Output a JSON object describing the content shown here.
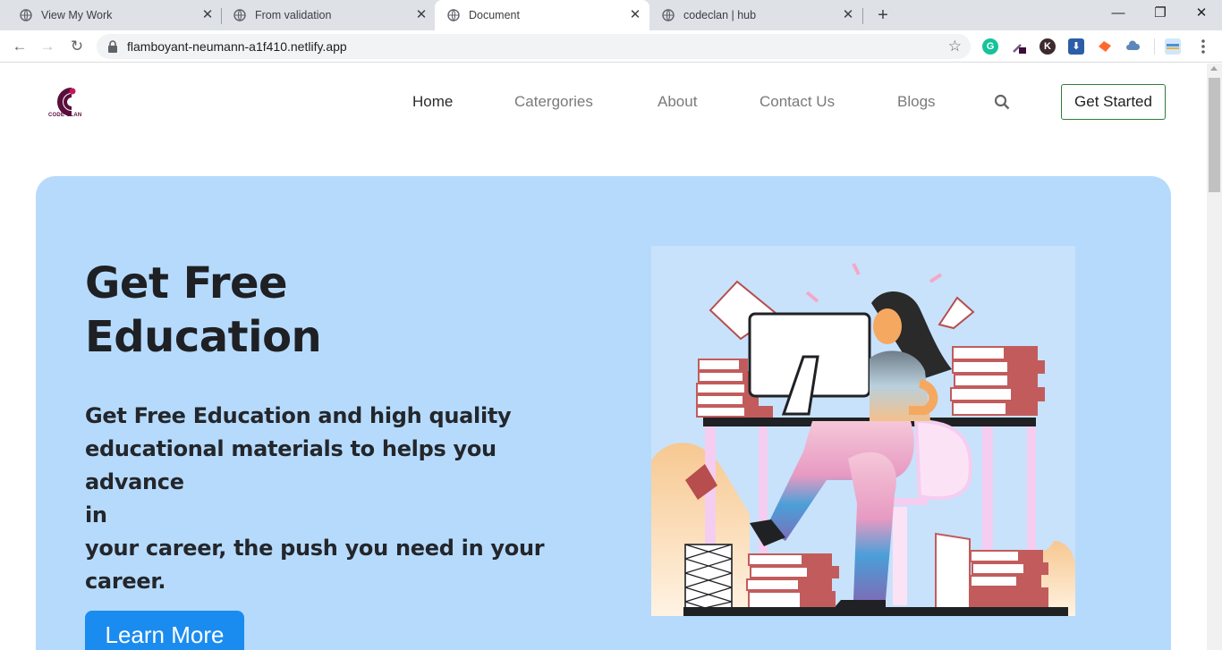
{
  "browser": {
    "tabs": [
      {
        "title": "View My Work",
        "active": false
      },
      {
        "title": "From validation",
        "active": false
      },
      {
        "title": "Document",
        "active": true
      },
      {
        "title": "codeclan | hub",
        "active": false
      }
    ],
    "url": "flamboyant-neumann-a1f410.netlify.app",
    "extensions": [
      "grammarly-icon",
      "eyedropper-icon",
      "k-extension-icon",
      "download-icon",
      "fox-extension-icon",
      "cloud-icon",
      "flag-extension-icon"
    ]
  },
  "site": {
    "logo_text": "CODE CLAN",
    "nav": [
      "Home",
      "Catergories",
      "About",
      "Contact Us",
      "Blogs"
    ],
    "active_nav": "Home",
    "cta_label": "Get Started"
  },
  "hero": {
    "title_line1": "Get Free",
    "title_line2": "Education",
    "subtitle_lines": [
      "Get Free Education and high quality",
      "educational materials to helps you advance",
      "in",
      "your career, the push you need in your",
      "career."
    ],
    "button_label": "Learn More"
  },
  "colors": {
    "hero_bg": "#b6dafc",
    "primary_button": "#1a8cf0",
    "cta_border": "#2e7d3c",
    "brand": "#5a0e3c"
  }
}
